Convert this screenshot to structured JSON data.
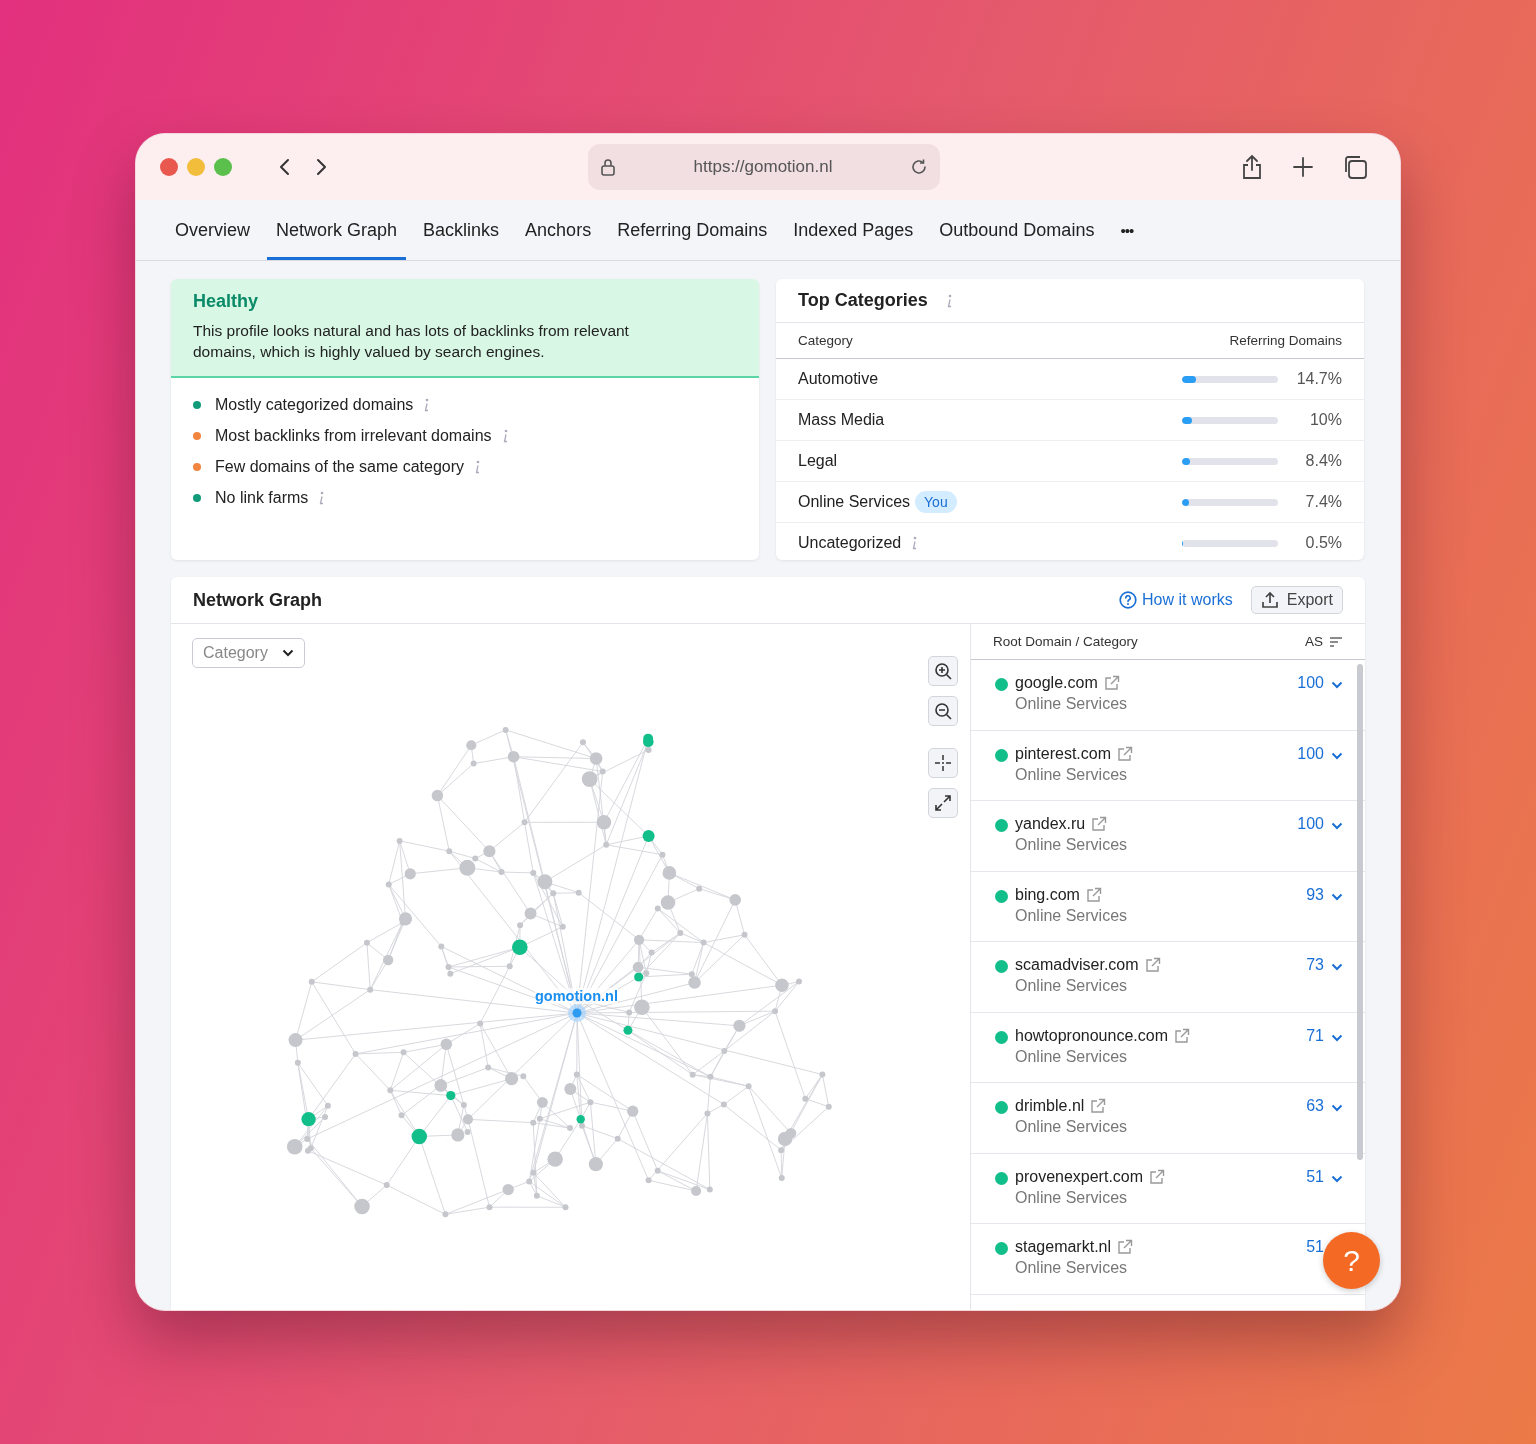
{
  "browser": {
    "url": "https://gomotion.nl"
  },
  "tabs": [
    {
      "label": "Overview",
      "selected": false
    },
    {
      "label": "Network Graph",
      "selected": true
    },
    {
      "label": "Backlinks",
      "selected": false
    },
    {
      "label": "Anchors",
      "selected": false
    },
    {
      "label": "Referring Domains",
      "selected": false
    },
    {
      "label": "Indexed Pages",
      "selected": false
    },
    {
      "label": "Outbound Domains",
      "selected": false
    }
  ],
  "tabs_more": "•••",
  "health": {
    "title": "Healthy",
    "description": "This profile looks natural and has lots of backlinks from relevant domains, which is highly valued by search engines.",
    "factors": [
      {
        "label": "Mostly categorized domains",
        "color": "#119b79"
      },
      {
        "label": "Most backlinks from irrelevant domains",
        "color": "#f2853f"
      },
      {
        "label": "Few domains of the same category",
        "color": "#f2853f"
      },
      {
        "label": "No link farms",
        "color": "#119b79"
      }
    ]
  },
  "top_categories": {
    "title": "Top Categories",
    "columns": [
      "Category",
      "Referring Domains"
    ],
    "rows": [
      {
        "name": "Automotive",
        "level": 0.147,
        "value": "14.7%",
        "info": false
      },
      {
        "name": "Mass Media",
        "level": 0.1,
        "value": "10%",
        "info": false
      },
      {
        "name": "Legal",
        "level": 0.084,
        "value": "8.4%",
        "info": false
      },
      {
        "name": "Online Services",
        "badge": "You",
        "level": 0.074,
        "value": "7.4%",
        "info": false
      },
      {
        "name": "Uncategorized",
        "level": 0.005,
        "value": "0.5%",
        "info": true
      }
    ]
  },
  "network_graph": {
    "title": "Network Graph",
    "how_it_works": "How it works",
    "export": "Export",
    "filter": "Category",
    "center_label": "gomotion.nl",
    "list": {
      "columns": [
        "Root Domain / Category",
        "AS"
      ],
      "rows": [
        {
          "domain": "google.com",
          "category": "Online Services",
          "score": "100",
          "chevron": true
        },
        {
          "domain": "pinterest.com",
          "category": "Online Services",
          "score": "100",
          "chevron": true
        },
        {
          "domain": "yandex.ru",
          "category": "Online Services",
          "score": "100",
          "chevron": true
        },
        {
          "domain": "bing.com",
          "category": "Online Services",
          "score": "93",
          "chevron": true
        },
        {
          "domain": "scamadviser.com",
          "category": "Online Services",
          "score": "73",
          "chevron": true
        },
        {
          "domain": "howtopronounce.com",
          "category": "Online Services",
          "score": "71",
          "chevron": true
        },
        {
          "domain": "drimble.nl",
          "category": "Online Services",
          "score": "63",
          "chevron": true
        },
        {
          "domain": "provenexpert.com",
          "category": "Online Services",
          "score": "51",
          "chevron": true
        },
        {
          "domain": "stagemarkt.nl",
          "category": "Online Services",
          "score": "51",
          "chevron": false
        }
      ]
    }
  },
  "help_button": "?"
}
